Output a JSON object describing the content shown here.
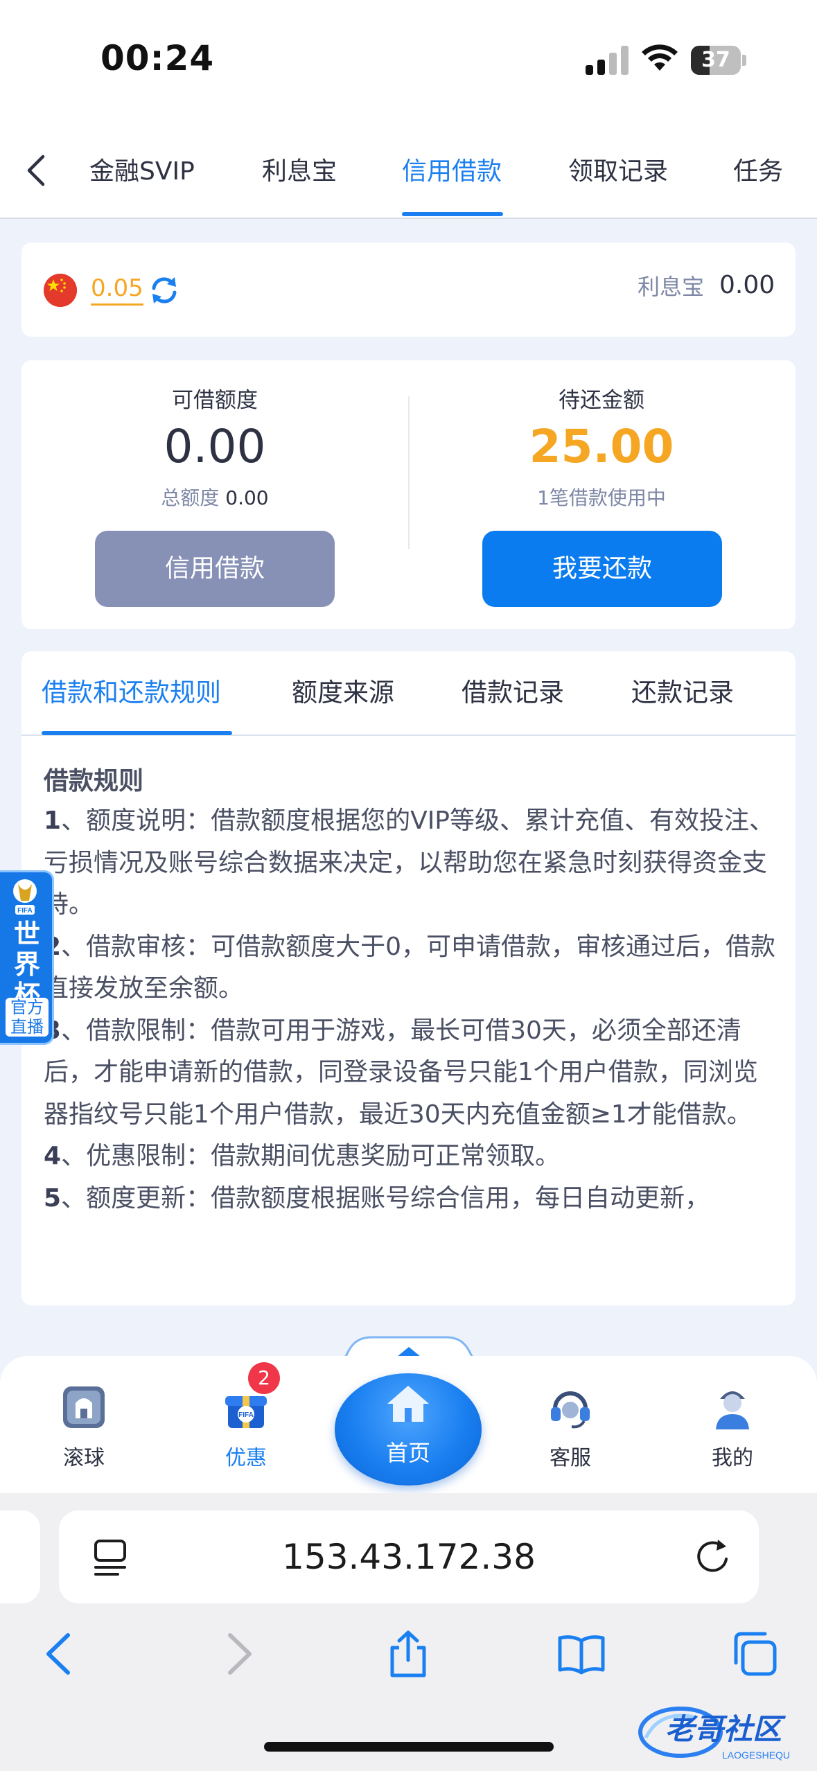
{
  "status_bar": {
    "time": "00:24",
    "battery": "37",
    "battery_level": 0.37
  },
  "top_tabs": {
    "items": [
      {
        "label": "金融SVIP",
        "active": false
      },
      {
        "label": "利息宝",
        "active": false
      },
      {
        "label": "信用借款",
        "active": true
      },
      {
        "label": "领取记录",
        "active": false
      },
      {
        "label": "任务",
        "active": false
      }
    ]
  },
  "wallet": {
    "balance": "0.05",
    "lixibao_label": "利息宝",
    "lixibao_value": "0.00"
  },
  "loan": {
    "available_label": "可借额度",
    "available_value": "0.00",
    "total_label": "总额度",
    "total_value": "0.00",
    "pending_label": "待还金额",
    "pending_value": "25.00",
    "pending_note": "1笔借款使用中",
    "credit_button": "信用借款",
    "repay_button": "我要还款"
  },
  "rules": {
    "tabs": [
      {
        "label": "借款和还款规则",
        "active": true
      },
      {
        "label": "额度来源",
        "active": false
      },
      {
        "label": "借款记录",
        "active": false
      },
      {
        "label": "还款记录",
        "active": false
      }
    ],
    "title": "借款规则",
    "items": [
      {
        "num": "1",
        "text": "、额度说明：借款额度根据您的VIP等级、累计充值、有效投注、亏损情况及账号综合数据来决定，以帮助您在紧急时刻获得资金支持。"
      },
      {
        "num": "2",
        "text": "、借款审核：可借款额度大于0，可申请借款，审核通过后，借款直接发放至余额。"
      },
      {
        "num": "3",
        "text": "、借款限制：借款可用于游戏，最长可借30天，必须全部还清后，才能申请新的借款，同登录设备号只能1个用户借款，同浏览器指纹号只能1个用户借款，最近30天内充值金额≥1才能借款。"
      },
      {
        "num": "4",
        "text": "、优惠限制：借款期间优惠奖励可正常领取。"
      },
      {
        "num": "5",
        "text": "、额度更新：借款额度根据账号综合信用，每日自动更新，"
      }
    ]
  },
  "world_cup_badge": {
    "logo": "FIFA",
    "title": "世界杯",
    "sub": "官方直播"
  },
  "bottom_tabs": {
    "items": [
      {
        "label": "滚球",
        "icon": "live-ball-icon"
      },
      {
        "label": "优惠",
        "icon": "gift-box-icon",
        "badge": "2",
        "active": true
      },
      {
        "label": "首页",
        "icon": "home-icon"
      },
      {
        "label": "客服",
        "icon": "headset-icon"
      },
      {
        "label": "我的",
        "icon": "user-icon"
      }
    ]
  },
  "browser": {
    "url": "153.43.172.38",
    "watermark": "老哥社区",
    "watermark_sub": "LAOGESHEQU"
  },
  "colors": {
    "accent": "#1a7ff0",
    "orange": "#f5a623",
    "disabled_button": "#8790b5",
    "badge_red": "#f0374a"
  }
}
